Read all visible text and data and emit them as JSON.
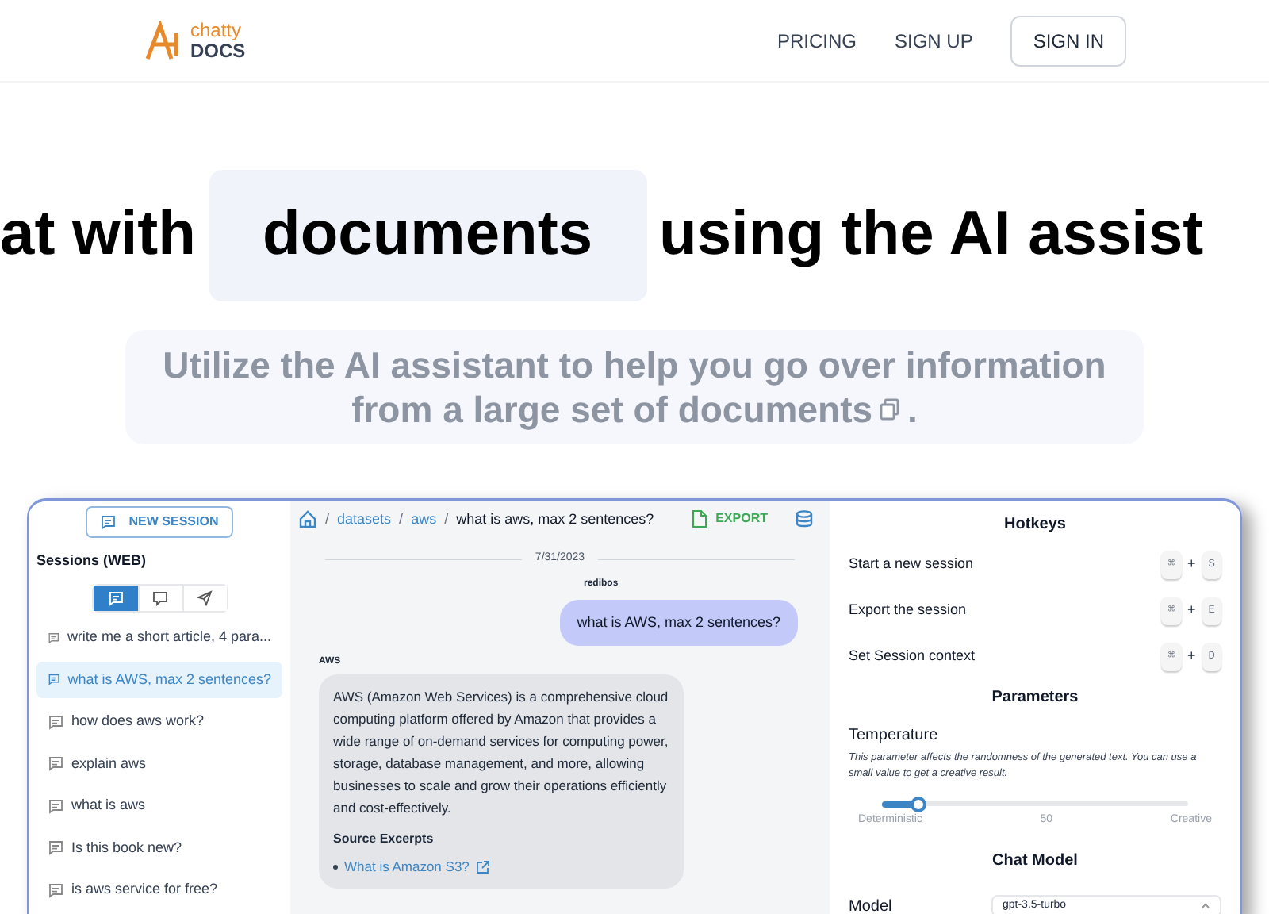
{
  "header": {
    "logo": {
      "top": "chatty",
      "bottom": "DOCS"
    },
    "nav": [
      {
        "label": "PRICING",
        "kind": "link"
      },
      {
        "label": "SIGN UP",
        "kind": "link"
      },
      {
        "label": "SIGN IN",
        "kind": "button"
      }
    ]
  },
  "hero": {
    "title_before": "at with",
    "title_highlight": "documents",
    "title_after": "using the AI assist",
    "subtitle_line1": "Utilize the AI assistant to help you go over information",
    "subtitle_line2": "from a large set of documents",
    "subtitle_end": "."
  },
  "sidebar": {
    "new_session": "NEW SESSION",
    "heading": "Sessions (WEB)",
    "filters": [
      {
        "kind": "chat",
        "selected": true
      },
      {
        "kind": "comment",
        "selected": false
      },
      {
        "kind": "send",
        "selected": false
      }
    ],
    "sessions": [
      {
        "label": "write me a short article, 4 para...",
        "selected": false
      },
      {
        "label": "what is AWS, max 2 sentences?",
        "selected": true
      },
      {
        "label": "how does aws work?",
        "selected": false
      },
      {
        "label": "explain aws",
        "selected": false
      },
      {
        "label": "what is aws",
        "selected": false
      },
      {
        "label": "Is this book new?",
        "selected": false
      },
      {
        "label": "is aws service for free?",
        "selected": false
      }
    ]
  },
  "chat": {
    "separator": "/",
    "breadcrumb": [
      "datasets",
      "aws"
    ],
    "current": "what is aws, max 2 sentences?",
    "export": "EXPORT",
    "date": "7/31/2023",
    "messages": [
      {
        "kind": "user",
        "author": "redibos",
        "text": "what is AWS, max 2 sentences?"
      },
      {
        "kind": "bot",
        "author": "AWS",
        "text": "AWS (Amazon Web Services) is a comprehensive cloud computing platform offered by Amazon that provides a wide range of on-demand services for computing power, storage, database management, and more, allowing businesses to scale and grow their operations efficiently and cost-effectively.",
        "sources_title": "Source Excerpts",
        "sources": [
          "What is Amazon S3?"
        ]
      }
    ]
  },
  "settings": {
    "hotkeys_title": "Hotkeys",
    "hotkeys": [
      {
        "label": "Start a new session",
        "modifier": "⌘",
        "joiner": "+",
        "key": "S"
      },
      {
        "label": "Export the session",
        "modifier": "⌘",
        "joiner": "+",
        "key": "E"
      },
      {
        "label": "Set Session context",
        "modifier": "⌘",
        "joiner": "+",
        "key": "D"
      }
    ],
    "parameters_title": "Parameters",
    "temperature": {
      "label": "Temperature",
      "description": "This parameter affects the randomness of the generated text. You can use a small value to get a creative result.",
      "level": 0.12,
      "ticks": [
        "Deterministic",
        "50",
        "Creative"
      ]
    },
    "chat_model_title": "Chat Model",
    "model": {
      "label": "Model",
      "value": "gpt-3.5-turbo"
    }
  }
}
